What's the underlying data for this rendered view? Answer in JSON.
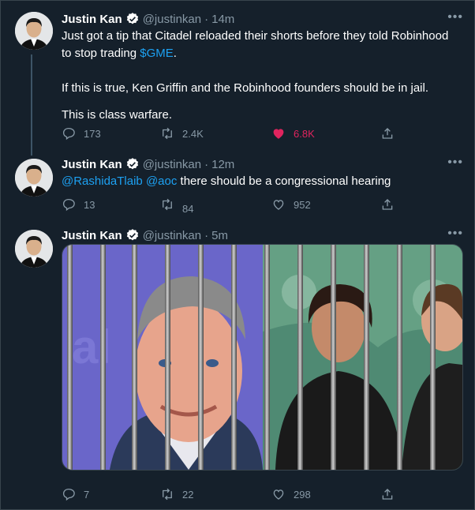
{
  "colors": {
    "background": "#15202b",
    "text": "#ffffff",
    "muted": "#8899a6",
    "link": "#1da1f2",
    "like_active": "#e0245e",
    "verified": "#1da1f2"
  },
  "tweets": [
    {
      "name": "Justin Kan",
      "handle": "@justinkan",
      "separator": "·",
      "time": "14m",
      "more": "•••",
      "text": {
        "line1_pre": "Just got a tip that Citadel reloaded their shorts before they told Robinhood to stop trading ",
        "cashtag": "$GME",
        "line1_post": ".",
        "paragraph2": "If this is true, Ken Griffin and the Robinhood founders should be in jail.",
        "paragraph3": "This is class warfare."
      },
      "replies": "173",
      "retweets": "2.4K",
      "likes": "6.8K",
      "liked": true
    },
    {
      "name": "Justin Kan",
      "handle": "@justinkan",
      "separator": "·",
      "time": "12m",
      "more": "•••",
      "text": {
        "mention1": "@RashidaTlaib",
        "mention2": "@aoc",
        "rest": " there should be a congressional hearing"
      },
      "replies": "13",
      "retweets": "84",
      "likes": "952",
      "liked": false
    },
    {
      "name": "Justin Kan",
      "handle": "@justinkan",
      "separator": "·",
      "time": "5m",
      "more": "•••",
      "replies": "7",
      "retweets": "22",
      "likes": "298",
      "liked": false
    }
  ],
  "icons": {
    "reply": "reply-bubble-icon",
    "retweet": "retweet-icon",
    "like": "heart-icon",
    "share": "share-icon",
    "verified": "verified-badge-icon"
  }
}
